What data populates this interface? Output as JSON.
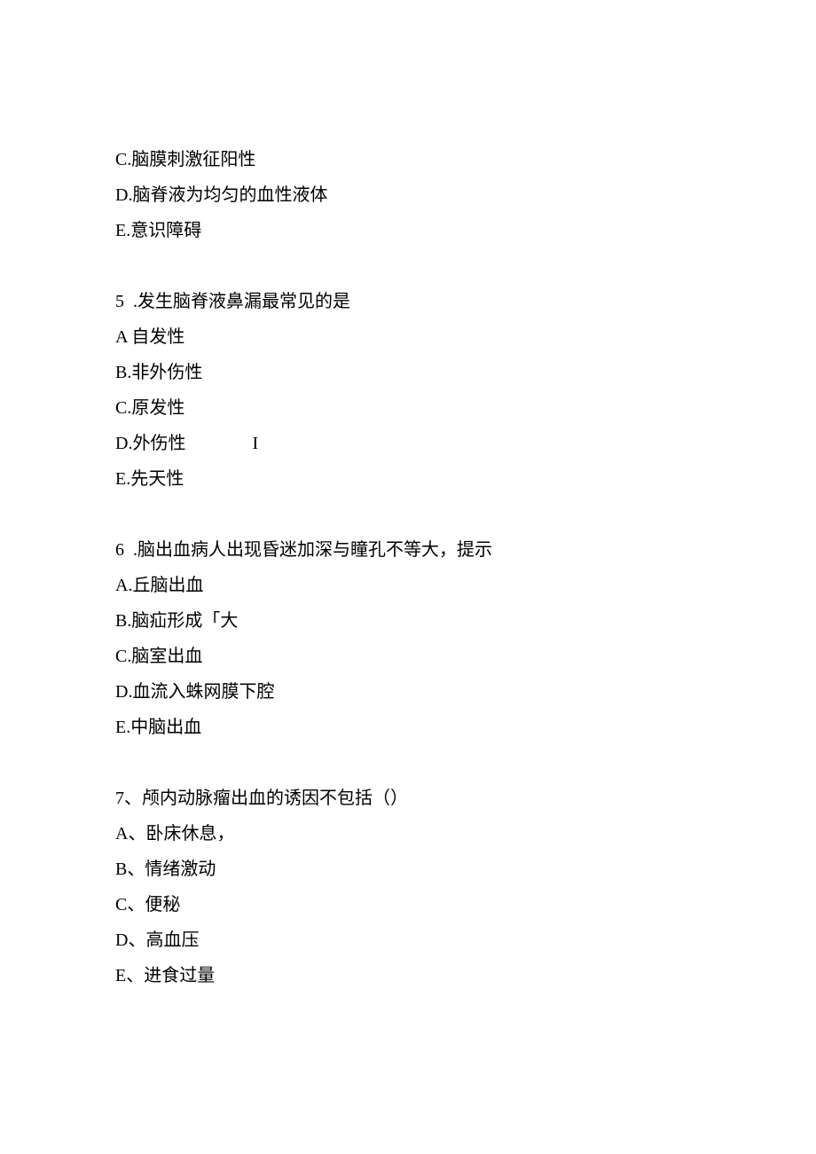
{
  "tail": {
    "C": "C.脑膜刺激征阳性",
    "D": "D.脑脊液为均匀的血性液体",
    "E": "E.意识障碍"
  },
  "q5": {
    "stem": "5  .发生脑脊液鼻漏最常见的是",
    "A": "A 自发性",
    "B": "B.非外伤性",
    "C": "C.原发性",
    "D": "D.外伤性               I",
    "E": "E.先天性"
  },
  "q6": {
    "stem": "6  .脑出血病人出现昏迷加深与瞳孔不等大，提示",
    "A": "A.丘脑出血",
    "B": "B.脑疝形成「大",
    "C": "C.脑室出血",
    "D": "D.血流入蛛网膜下腔",
    "E": "E.中脑出血"
  },
  "q7": {
    "stem": "7、颅内动脉瘤出血的诱因不包括（）",
    "A": "A、卧床休息，",
    "B": "B、情绪激动",
    "C": "C、便秘",
    "D": "D、高血压",
    "E": "E、进食过量"
  }
}
